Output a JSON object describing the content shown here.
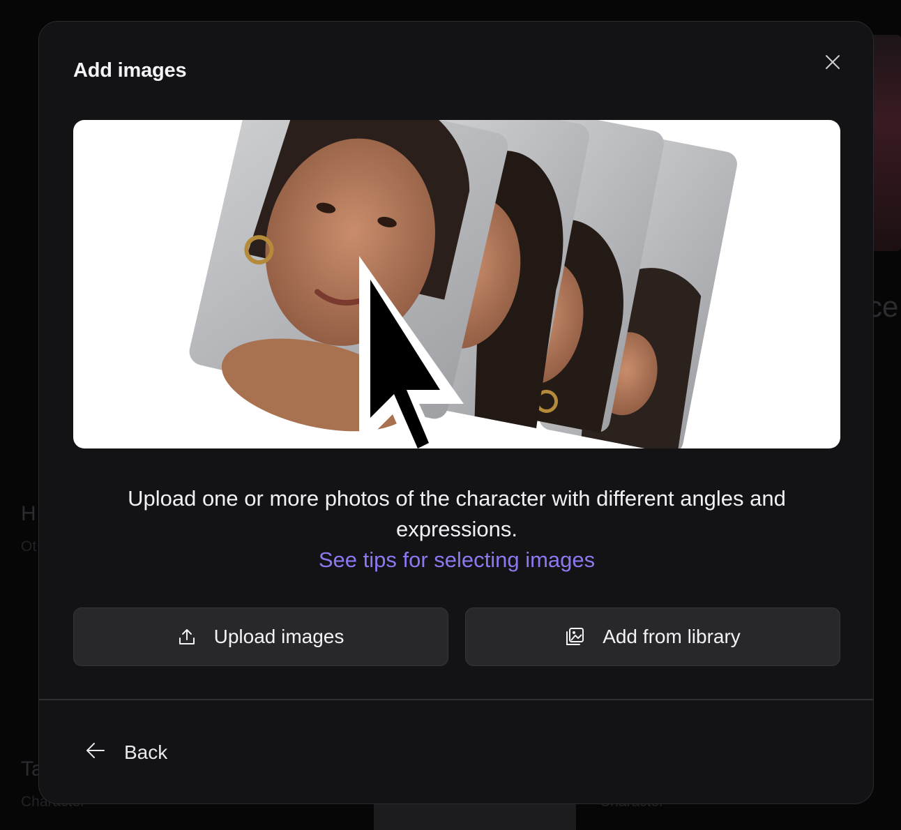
{
  "background": {
    "left_title": "H",
    "left_subtitle": "Ot",
    "left_bottom_title": "Ta",
    "left_bottom_subtitle": "Character",
    "right_bottom_subtitle": "Character",
    "right_fragment": "ce"
  },
  "modal": {
    "title": "Add images",
    "close_icon": "close-icon",
    "description": "Upload one or more photos of the character with different angles and expressions.",
    "tips_link": "See tips for selecting images",
    "upload_button": "Upload images",
    "upload_icon": "upload-icon",
    "library_button": "Add from library",
    "library_icon": "image-library-icon",
    "back_button": "Back",
    "back_icon": "arrow-left-icon"
  },
  "colors": {
    "modal_bg": "#131316",
    "button_bg": "#27272c",
    "link": "#8c78f0",
    "text": "#f1f1f3"
  }
}
